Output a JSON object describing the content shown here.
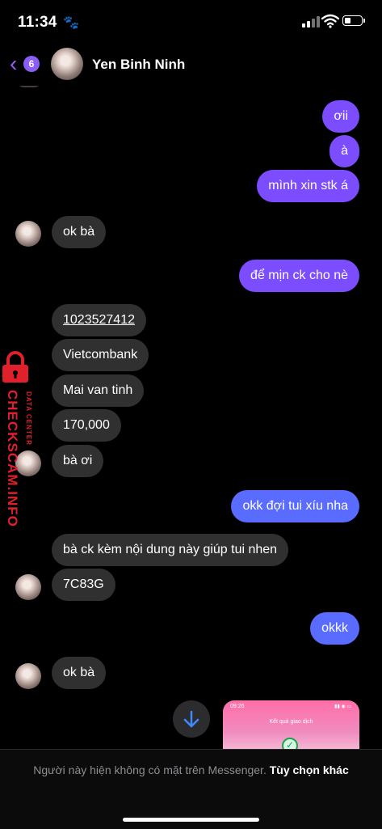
{
  "status_bar": {
    "time": "11:34",
    "paw_icon": "🐾",
    "battery_level": 0.3
  },
  "header": {
    "back_badge": "6",
    "contact_name": "Yen Binh Ninh"
  },
  "messages": [
    {
      "text": "ơii",
      "dir": "out"
    },
    {
      "text": "à",
      "dir": "out"
    },
    {
      "text": "mình xin stk á",
      "dir": "out"
    },
    {
      "text": "ok bà",
      "dir": "in"
    },
    {
      "text": "để mịn ck cho nè",
      "dir": "out"
    },
    {
      "text": "1023527412",
      "dir": "in"
    },
    {
      "text": "Vietcombank",
      "dir": "in"
    },
    {
      "text": "Mai van tinh",
      "dir": "in"
    },
    {
      "text": "170,000",
      "dir": "in"
    },
    {
      "text": "bà ơi",
      "dir": "in"
    },
    {
      "text": "okk đợi tui xíu nha",
      "dir": "out"
    },
    {
      "text": "bà ck kèm nội dung này giúp tui nhen",
      "dir": "in"
    },
    {
      "text": "7C83G",
      "dir": "in"
    },
    {
      "text": "okkk",
      "dir": "out"
    },
    {
      "text": "ok bà",
      "dir": "in"
    }
  ],
  "watermark": {
    "line1": "CHECKSCAM.INFO",
    "line2": "DATA CENTER"
  },
  "preview": {
    "time": "09:26",
    "title": "Kết quả giao dịch"
  },
  "footer": {
    "notice": "Người này hiện không có mặt trên Messenger.",
    "option": "Tùy chọn khác"
  },
  "colors": {
    "outgoing_purple": "#7b4dff",
    "outgoing_blue": "#5a6bff",
    "incoming": "#303030",
    "accent": "#9b5cf6",
    "watermark_red": "#e0202a"
  },
  "icons": {
    "back": "chevron-left-icon",
    "scroll_down": "arrow-down-icon"
  }
}
